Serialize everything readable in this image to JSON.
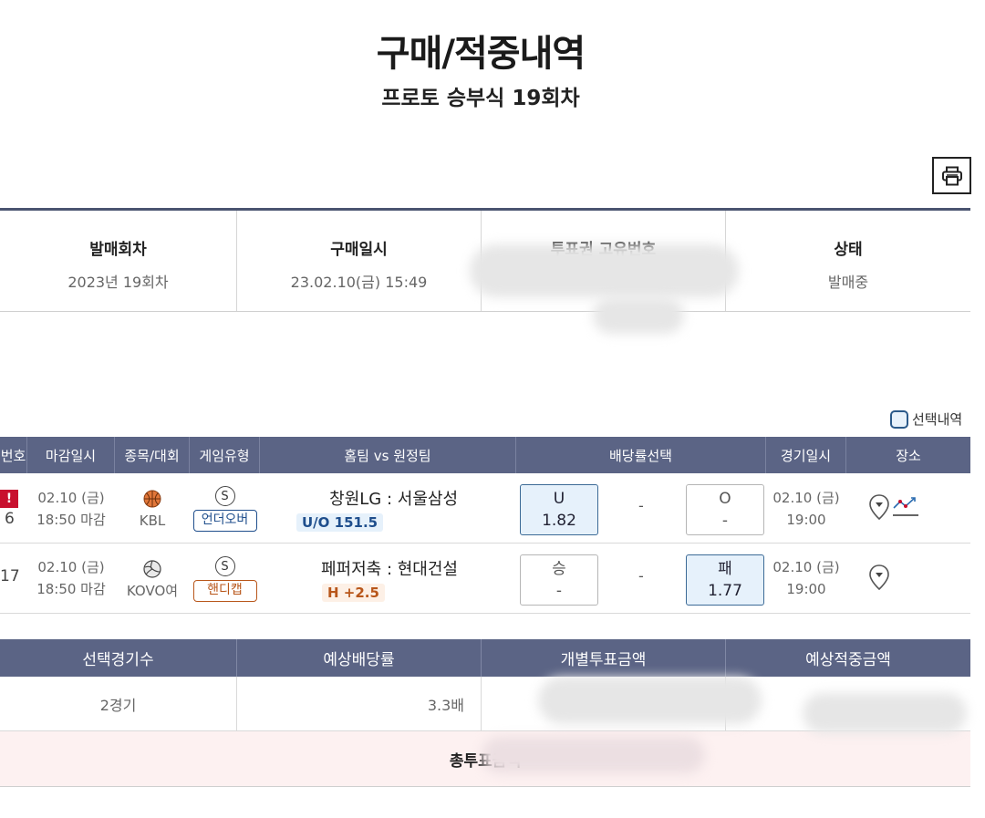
{
  "page": {
    "title": "구매/적중내역",
    "subtitle": "프로토 승부식 19회차"
  },
  "toolbar": {
    "print_icon": "printer-icon"
  },
  "info": [
    {
      "label": "발매회차",
      "value": "2023년 19회차"
    },
    {
      "label": "구매일시",
      "value": "23.02.10(금) 15:49"
    },
    {
      "label": "투표권 고유번호",
      "value": ""
    },
    {
      "label": "상태",
      "value": "발매중"
    }
  ],
  "select_toggle": {
    "label": "선택내역"
  },
  "games": {
    "headers": {
      "no": "번호",
      "deadline": "마감일시",
      "sport": "종목/대회",
      "type": "게임유형",
      "match": "홈팀 vs 원정팀",
      "odds": "배당률선택",
      "date": "경기일시",
      "place": "장소"
    },
    "rows": [
      {
        "no": "6",
        "alert": "!",
        "deadline_date": "02.10 (금)",
        "deadline_time": "18:50 마감",
        "league": "KBL",
        "sport_icon": "basketball-icon",
        "type_mark": "S",
        "type_label": "언더오버",
        "teams": "창원LG : 서울삼성",
        "handicap": "U/O 151.5",
        "odd1_label": "U",
        "odd1_value": "1.82",
        "mid": "-",
        "odd2_label": "O",
        "odd2_value": "-",
        "game_date": "02.10 (금)",
        "game_time": "19:00",
        "accent": "#1f4e8c"
      },
      {
        "no": "17",
        "deadline_date": "02.10 (금)",
        "deadline_time": "18:50 마감",
        "league": "KOVO여",
        "sport_icon": "volleyball-icon",
        "type_mark": "S",
        "type_label": "핸디캡",
        "teams": "페퍼저축 : 현대건설",
        "handicap": "H +2.5",
        "odd1_label": "승",
        "odd1_value": "-",
        "mid": "-",
        "odd2_label": "패",
        "odd2_value": "1.77",
        "game_date": "02.10 (금)",
        "game_time": "19:00",
        "accent": "#b8561a"
      }
    ]
  },
  "summary": {
    "headers": [
      "선택경기수",
      "예상배당률",
      "개별투표금액",
      "예상적중금액"
    ],
    "games_count": "2경기",
    "odds": "3.3배",
    "total_label": "총투표금액"
  }
}
